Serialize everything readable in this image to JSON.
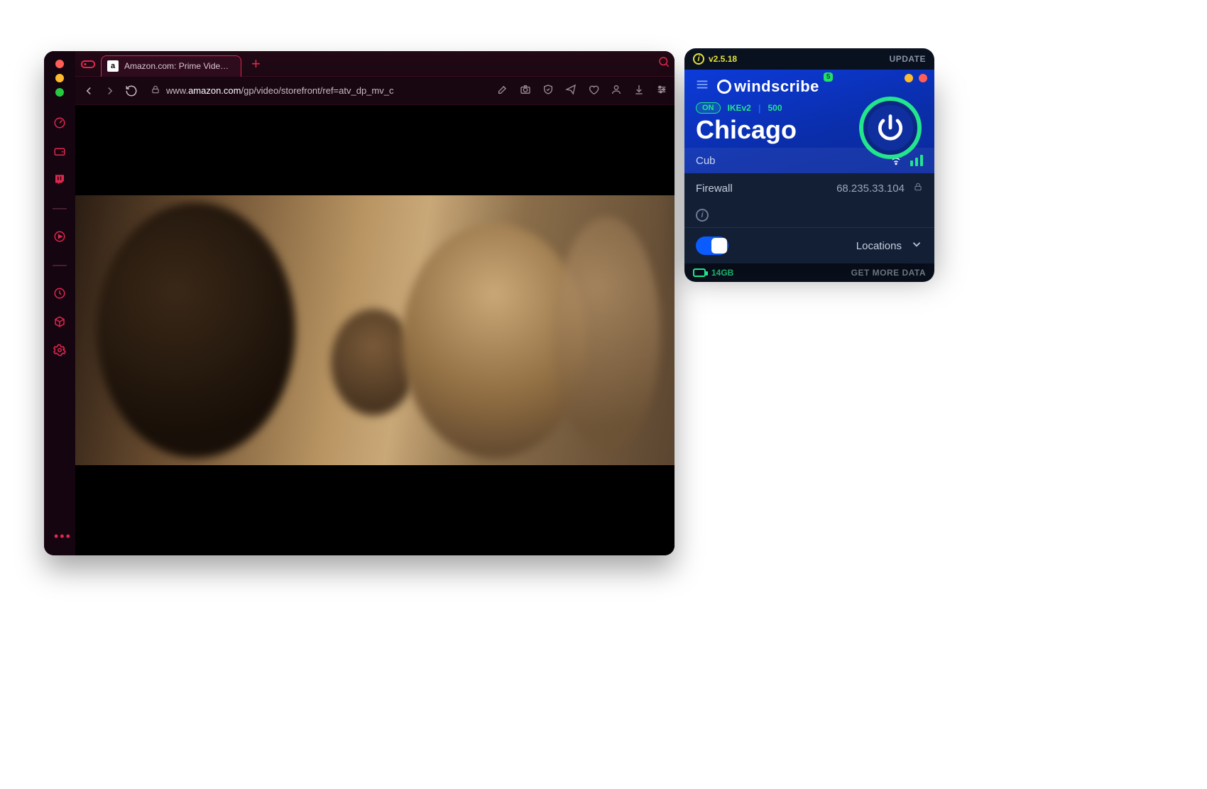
{
  "browser": {
    "tab_title": "Amazon.com: Prime Video: Prin",
    "favicon_letter": "a",
    "url_host": "amazon.com",
    "url_prefix": "www.",
    "url_path": "/gp/video/storefront/ref=atv_dp_mv_c"
  },
  "windscribe": {
    "version": "v2.5.18",
    "update_label": "UPDATE",
    "brand": "windscribe",
    "notif_badge": "5",
    "status": "ON",
    "protocol": "IKEv2",
    "port": "500",
    "city": "Chicago",
    "node": "Cub",
    "firewall_label": "Firewall",
    "ip": "68.235.33.104",
    "locations_label": "Locations",
    "data_remaining": "14GB",
    "get_more": "GET MORE DATA"
  }
}
